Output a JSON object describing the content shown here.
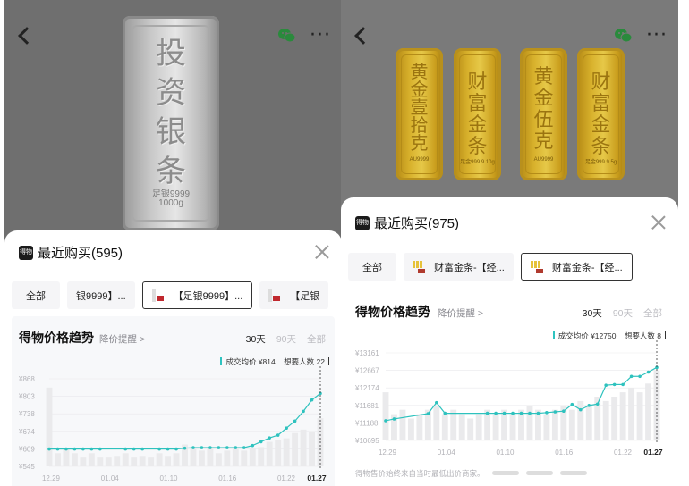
{
  "left": {
    "bar_text": [
      "投",
      "资",
      "银",
      "条"
    ],
    "bar_small": [
      "足银9999",
      "1000g"
    ],
    "sheet_title": "最近购买(595)",
    "app_icon_text": "得物",
    "filters": [
      {
        "label": "全部",
        "type": "all"
      },
      {
        "label": "银9999】...",
        "type": "plain"
      },
      {
        "label": "【足银9999】...",
        "type": "active"
      },
      {
        "label": "【足银",
        "type": "plain"
      }
    ],
    "card_title": "得物价格趋势",
    "reminder": "降价提醒 >",
    "ranges": [
      {
        "label": "30天",
        "on": true
      },
      {
        "label": "90天",
        "on": false
      },
      {
        "label": "全部",
        "on": false
      }
    ],
    "legend_avg": "成交均价 ¥814",
    "legend_want": "想要人数 22",
    "chart_data": {
      "type": "line",
      "series_name": "成交均价",
      "y_ticks": [
        "¥868",
        "¥803",
        "¥738",
        "¥674",
        "¥609",
        "¥545"
      ],
      "x_ticks": [
        "12.29",
        "01.04",
        "01.10",
        "01.16",
        "01.22",
        "01.27"
      ],
      "ylim": [
        545,
        868
      ],
      "values": [
        609,
        609,
        609,
        609,
        609,
        609,
        609,
        null,
        null,
        609,
        609,
        609,
        null,
        609,
        609,
        609,
        612,
        614,
        614,
        614,
        614,
        614,
        614,
        614,
        622,
        636,
        650,
        660,
        686,
        712,
        748,
        790,
        814
      ],
      "volume": [
        0.9,
        0.15,
        0.2,
        0.15,
        0.1,
        0.15,
        0.1,
        0.1,
        0.12,
        0.15,
        0.1,
        0.12,
        0.1,
        0.15,
        0.12,
        0.15,
        0.25,
        0.2,
        0.18,
        0.2,
        0.15,
        0.18,
        0.2,
        0.18,
        0.2,
        0.22,
        0.28,
        0.3,
        0.32,
        0.38,
        0.42,
        0.4,
        0.55
      ]
    }
  },
  "right": {
    "bars": [
      {
        "text": [
          "黄",
          "金",
          "壹",
          "拾",
          "克"
        ],
        "tiny": "AU9999"
      },
      {
        "text": [
          "财",
          "富",
          "金",
          "条"
        ],
        "tiny": "足金999.9 10g"
      },
      {
        "text": [
          "黄",
          "金",
          "伍",
          "克"
        ],
        "tiny": "AU9999"
      },
      {
        "text": [
          "财",
          "富",
          "金",
          "条"
        ],
        "tiny": "足金999.9 5g"
      }
    ],
    "sheet_title": "最近购买(975)",
    "app_icon_text": "得物",
    "filters": [
      {
        "label": "全部",
        "type": "all"
      },
      {
        "label": "财富金条-【经...",
        "type": "plain"
      },
      {
        "label": "财富金条-【经...",
        "type": "active"
      }
    ],
    "card_title": "得物价格趋势",
    "reminder": "降价提醒 >",
    "ranges": [
      {
        "label": "30天",
        "on": true
      },
      {
        "label": "90天",
        "on": false
      },
      {
        "label": "全部",
        "on": false
      }
    ],
    "legend_avg": "成交均价 ¥12750",
    "legend_want": "想要人数 8",
    "footnote": "得物售价始终来自当时最低出价商家。",
    "chart_data": {
      "type": "line",
      "series_name": "成交均价",
      "y_ticks": [
        "¥13161",
        "¥12667",
        "¥12174",
        "¥11681",
        "¥11188",
        "¥10695"
      ],
      "x_ticks": [
        "12.29",
        "01.04",
        "01.10",
        "01.16",
        "01.22",
        "01.27"
      ],
      "ylim": [
        10695,
        13161
      ],
      "values": [
        11250,
        11300,
        null,
        null,
        null,
        11450,
        11760,
        11460,
        null,
        null,
        null,
        null,
        11460,
        11460,
        11460,
        11460,
        11460,
        11460,
        11460,
        11480,
        11500,
        11520,
        11710,
        11560,
        11680,
        11720,
        12250,
        12270,
        12270,
        12500,
        12500,
        12620,
        12750
      ],
      "volume": [
        0.55,
        0.3,
        0.35,
        0.25,
        0.3,
        0.35,
        0.4,
        0.3,
        0.35,
        0.3,
        0.25,
        0.3,
        0.35,
        0.3,
        0.35,
        0.3,
        0.35,
        0.4,
        0.35,
        0.3,
        0.35,
        0.4,
        0.35,
        0.45,
        0.4,
        0.5,
        0.45,
        0.5,
        0.55,
        0.6,
        0.55,
        0.65,
        0.8
      ]
    }
  },
  "colors": {
    "line": "#2ec2be",
    "volume": "#eaeaec",
    "grid": "#e9e9ec"
  }
}
